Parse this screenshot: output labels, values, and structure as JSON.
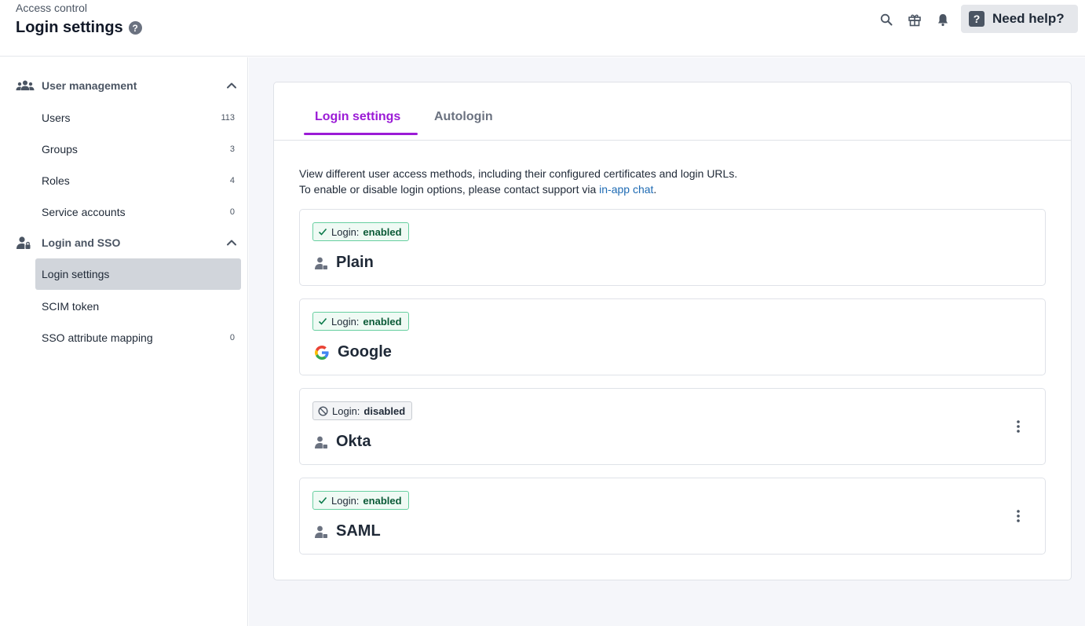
{
  "header": {
    "breadcrumb": "Access control",
    "title": "Login settings",
    "help_button": "Need help?"
  },
  "sidebar": {
    "sections": [
      {
        "title": "User management",
        "items": [
          {
            "label": "Users",
            "count": "113"
          },
          {
            "label": "Groups",
            "count": "3"
          },
          {
            "label": "Roles",
            "count": "4"
          },
          {
            "label": "Service accounts",
            "count": "0"
          }
        ]
      },
      {
        "title": "Login and SSO",
        "items": [
          {
            "label": "Login settings",
            "count": ""
          },
          {
            "label": "SCIM token",
            "count": ""
          },
          {
            "label": "SSO attribute mapping",
            "count": "0"
          }
        ]
      }
    ]
  },
  "main": {
    "tabs": [
      {
        "label": "Login settings"
      },
      {
        "label": "Autologin"
      }
    ],
    "description_line1": "View different user access methods, including their configured certificates and login URLs.",
    "description_line2_prefix": "To enable or disable login options, please contact support via ",
    "description_link": "in-app chat",
    "description_line2_suffix": ".",
    "methods": [
      {
        "status_prefix": "Login:",
        "status": "enabled",
        "name": "Plain",
        "icon": "user-icon"
      },
      {
        "status_prefix": "Login:",
        "status": "enabled",
        "name": "Google",
        "icon": "google-logo-icon"
      },
      {
        "status_prefix": "Login:",
        "status": "disabled",
        "name": "Okta",
        "icon": "user-icon"
      },
      {
        "status_prefix": "Login:",
        "status": "enabled",
        "name": "SAML",
        "icon": "user-icon"
      }
    ]
  },
  "colors": {
    "accent": "#9b1bd6",
    "link": "#1d6ab3",
    "enabled_border": "#67cfa0",
    "enabled_bg": "#effaf4",
    "active_nav_bg": "#d1d5db"
  }
}
